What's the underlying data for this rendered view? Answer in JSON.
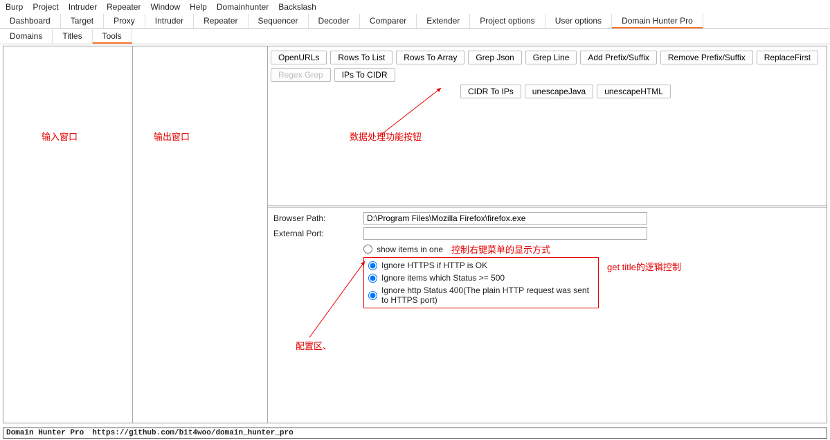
{
  "menubar": [
    "Burp",
    "Project",
    "Intruder",
    "Repeater",
    "Window",
    "Help",
    "Domainhunter",
    "Backslash"
  ],
  "tabs_main": [
    "Dashboard",
    "Target",
    "Proxy",
    "Intruder",
    "Repeater",
    "Sequencer",
    "Decoder",
    "Comparer",
    "Extender",
    "Project options",
    "User options",
    "Domain Hunter Pro"
  ],
  "tabs_main_active": "Domain Hunter Pro",
  "tabs_sub": [
    "Domains",
    "Titles",
    "Tools"
  ],
  "tabs_sub_active": "Tools",
  "buttons_row1": [
    "OpenURLs",
    "Rows To List",
    "Rows To Array",
    "Grep Json",
    "Grep Line",
    "Add Prefix/Suffix",
    "Remove Prefix/Suffix",
    "ReplaceFirst",
    "Regex Grep",
    "IPs To CIDR"
  ],
  "buttons_row1_disabled": [
    "Regex Grep"
  ],
  "buttons_row2": [
    "CIDR To IPs",
    "unescapeJava",
    "unescapeHTML"
  ],
  "annotations": {
    "input_pane": "输入窗口",
    "output_pane": "输出窗口",
    "button_area": "数据处理功能按钮",
    "radio_hint": "控制右键菜单的显示方式",
    "logic_hint": "get title的逻辑控制",
    "config_label": "配置区、"
  },
  "config": {
    "browser_path_label": "Browser Path:",
    "browser_path_value": "D:\\Program Files\\Mozilla Firefox\\firefox.exe",
    "external_port_label": "External Port:",
    "external_port_value": "",
    "show_items_label": "show items in one",
    "options": [
      "Ignore HTTPS if HTTP is OK",
      "Ignore items which Status >= 500",
      "Ignore http Status 400(The plain HTTP request was sent to HTTPS port)"
    ]
  },
  "statusbar": {
    "name": "Domain Hunter Pro",
    "url": "https://github.com/bit4woo/domain_hunter_pro"
  }
}
